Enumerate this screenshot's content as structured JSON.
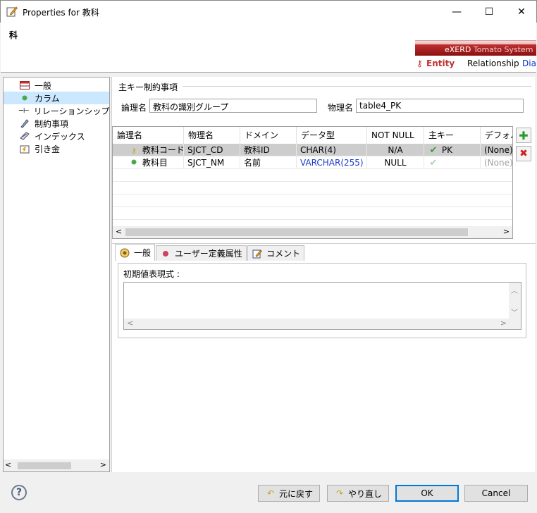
{
  "window": {
    "title": "Properties for 教科"
  },
  "header": {
    "entity_title": "科",
    "brand": "eXERD",
    "brand_system": "Tomato System",
    "tabs": [
      "Entity",
      "Relationship",
      "Diag"
    ]
  },
  "window_buttons": {
    "minimize": "—",
    "maximize": "☐",
    "close": "✕"
  },
  "tree": {
    "items": [
      {
        "label": "一般",
        "icon": "table-icon"
      },
      {
        "label": "カラム",
        "icon": "column-dot-icon",
        "selected": true
      },
      {
        "label": "リレーションシップ",
        "icon": "relationship-icon"
      },
      {
        "label": "制約事項",
        "icon": "constraint-icon"
      },
      {
        "label": "インデックス",
        "icon": "index-icon"
      },
      {
        "label": "引き金",
        "icon": "trigger-icon"
      }
    ]
  },
  "pk_group": {
    "title": "主キー制約事項",
    "logical_label": "論理名",
    "logical_value": "教科の識別グループ",
    "physical_label": "物理名",
    "physical_value": "table4_PK"
  },
  "table": {
    "headers": [
      "論理名",
      "物理名",
      "ドメイン",
      "データ型",
      "NOT NULL",
      "主キー",
      "デフォル"
    ],
    "rows": [
      {
        "logical": "教科コード",
        "physical": "SJCT_CD",
        "domain": "教科ID",
        "datatype": "CHAR(4)",
        "not_null": "N/A",
        "pk": "PK",
        "default": "(None)",
        "icon": "key-icon",
        "selected": true
      },
      {
        "logical": "教科目",
        "physical": "SJCT_NM",
        "domain": "名前",
        "datatype": "VARCHAR(255)",
        "not_null": "NULL",
        "pk": "",
        "default": "(None)",
        "icon": "column-dot-icon",
        "selected": false
      }
    ]
  },
  "bottom_tabs": [
    {
      "label": "一般",
      "icon": "general-tab-icon",
      "active": true
    },
    {
      "label": "ユーザー定義属性",
      "icon": "user-attr-icon",
      "active": false
    },
    {
      "label": "コメント",
      "icon": "comment-icon",
      "active": false
    }
  ],
  "tab_body": {
    "label": "初期値表現式 :"
  },
  "footer": {
    "help": "?",
    "undo": "元に戻す",
    "redo": "やり直し",
    "ok": "OK",
    "cancel": "Cancel"
  }
}
